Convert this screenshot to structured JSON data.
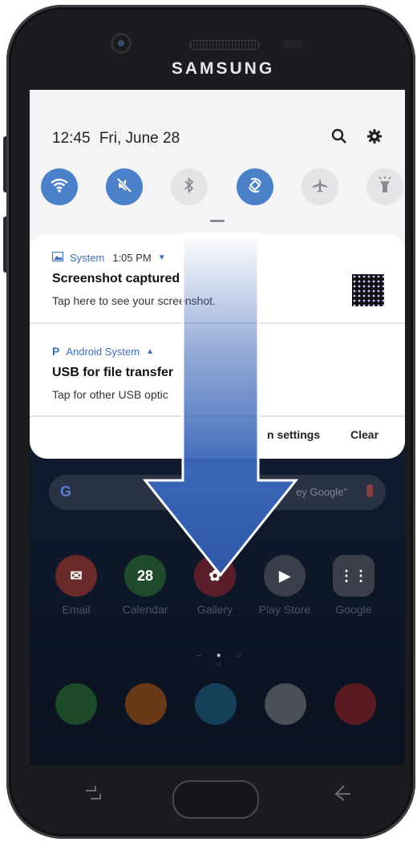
{
  "device": {
    "brand": "SAMSUNG"
  },
  "status": {
    "time": "12:45",
    "date": "Fri, June 28"
  },
  "header_icons": {
    "search": "search-icon",
    "settings": "gear-icon"
  },
  "quick_settings": [
    {
      "name": "wifi",
      "icon": "wifi-icon",
      "state": "on"
    },
    {
      "name": "sound",
      "icon": "mute-icon",
      "state": "on"
    },
    {
      "name": "bluetooth",
      "icon": "bluetooth-icon",
      "state": "off"
    },
    {
      "name": "auto-rotate",
      "icon": "rotate-icon",
      "state": "on"
    },
    {
      "name": "airplane",
      "icon": "airplane-icon",
      "state": "off"
    },
    {
      "name": "flashlight",
      "icon": "flashlight-icon",
      "state": "off"
    }
  ],
  "notifications": [
    {
      "app": "System",
      "time": "1:05 PM",
      "title": "Screenshot captured",
      "body": "Tap here to see your screenshot."
    },
    {
      "app": "Android System",
      "title": "USB for file transfer",
      "body": "Tap for other USB optic"
    }
  ],
  "panel_actions": {
    "settings": "n settings",
    "clear": "Clear"
  },
  "home": {
    "search_hint": "ey Google\"",
    "apps": [
      "Email",
      "Calendar",
      "Gallery",
      "Play Store",
      "Google"
    ],
    "calendar_day": "28"
  },
  "colors": {
    "accent": "#4a81c8",
    "arrow": "#3a66b8"
  }
}
